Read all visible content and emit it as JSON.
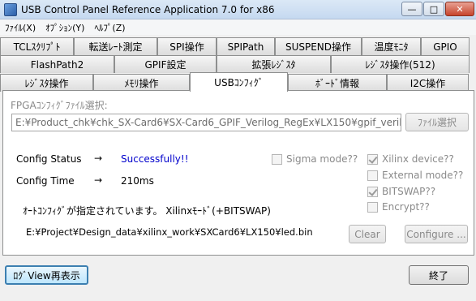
{
  "window": {
    "title": "USB Control Panel Reference Application 7.0 for x86",
    "min_glyph": "—",
    "max_glyph": "□",
    "close_glyph": "✕"
  },
  "menu": [
    "ﾌｧｲﾙ(X)",
    "ｵﾌﾟｼｮﾝ(Y)",
    "ﾍﾙﾌﾟ(Z)"
  ],
  "tabs": {
    "row1": [
      "TCLｽｸﾘﾌﾟﾄ",
      "転送ﾚｰﾄ測定",
      "SPI操作",
      "SPIPath",
      "SUSPEND操作",
      "温度ﾓﾆﾀ",
      "GPIO"
    ],
    "row2": [
      "FlashPath2",
      "GPIF設定",
      "拡張ﾚｼﾞｽﾀ",
      "ﾚｼﾞｽﾀ操作(512)"
    ],
    "row3": [
      "ﾚｼﾞｽﾀ操作",
      "ﾒﾓﾘ操作",
      "USBｺﾝﾌｨｸﾞ",
      "ﾎﾞｰﾄﾞ情報",
      "I2C操作"
    ],
    "active": "USBｺﾝﾌｨｸﾞ"
  },
  "fpga": {
    "label": "FPGAｺﾝﾌｨｸﾞﾌｧｲﾙ選択:",
    "path": "E:¥Product_chk¥chk_SX-Card6¥SX-Card6_GPIF_Verilog_RegEx¥LX150¥gpif_verilo",
    "select_button": "ﾌｧｲﾙ選択"
  },
  "config": {
    "status_label": "Config Status",
    "status_arrow": "→",
    "status_value": "Successfully!!",
    "time_label": "Config Time",
    "time_arrow": "→",
    "time_value": "210ms"
  },
  "options": {
    "sigma_mode": {
      "label": "Sigma mode??",
      "checked": false
    },
    "xilinx_device": {
      "label": "Xilinx device??",
      "checked": true
    },
    "external_mode": {
      "label": "External mode??",
      "checked": false
    },
    "bitswap": {
      "label": "BITSWAP??",
      "checked": true
    },
    "encrypt": {
      "label": "Encrypt??",
      "checked": false
    }
  },
  "auto_config_msg": "ｵｰﾄｺﾝﾌｨｸﾞが指定されています。 Xilinxﾓｰﾄﾞ(+BITSWAP)",
  "bin_path": "E:¥Project¥Design_data¥xilinx_work¥SXCard6¥LX150¥led.bin",
  "buttons": {
    "clear": "Clear",
    "configure": "Configure ...",
    "log_view": "ﾛｸﾞView再表示",
    "exit": "終了"
  },
  "colors": {
    "status_value": "#0000cc",
    "disabled_text": "#8a8a8a"
  }
}
